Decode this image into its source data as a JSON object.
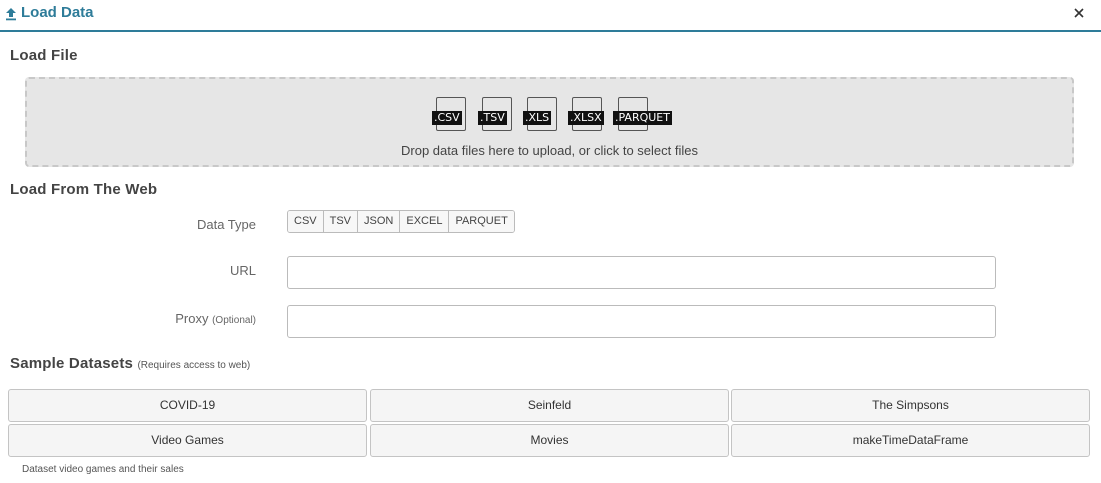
{
  "header": {
    "title": "Load Data",
    "icon": "upload-icon",
    "close_icon": "close-icon",
    "accent_color": "#2e7c99"
  },
  "load_file": {
    "title": "Load File",
    "file_types": [
      ".CSV",
      ".TSV",
      ".XLS",
      ".XLSX",
      ".PARQUET"
    ],
    "dropzone_text": "Drop data files here to upload, or click to select files"
  },
  "load_web": {
    "title": "Load From The Web",
    "data_type_label": "Data Type",
    "data_types": [
      "CSV",
      "TSV",
      "JSON",
      "EXCEL",
      "PARQUET"
    ],
    "url_label": "URL",
    "url_value": "",
    "proxy_label": "Proxy",
    "proxy_optional": "(Optional)",
    "proxy_value": ""
  },
  "samples": {
    "title": "Sample Datasets",
    "note": "(Requires access to web)",
    "datasets": [
      "COVID-19",
      "Seinfeld",
      "The Simpsons",
      "Video Games",
      "Movies",
      "makeTimeDataFrame"
    ],
    "description": "Dataset video games and their sales"
  }
}
